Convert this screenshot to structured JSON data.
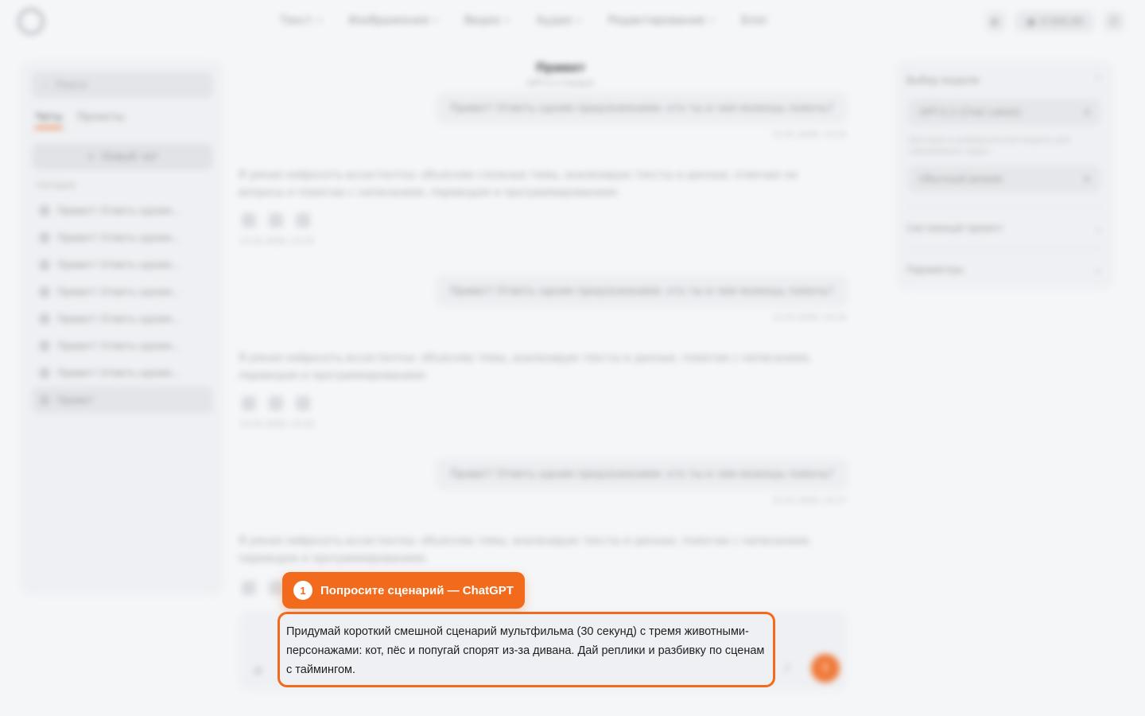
{
  "nav": {
    "items": [
      {
        "label": "Текст",
        "chevron": true
      },
      {
        "label": "Изображения",
        "chevron": true
      },
      {
        "label": "Видео",
        "chevron": true
      },
      {
        "label": "Аудио",
        "chevron": true
      },
      {
        "label": "Редактирование",
        "chevron": true
      },
      {
        "label": "Блог",
        "chevron": false
      }
    ]
  },
  "header": {
    "balance": "0 000,00"
  },
  "sidebar": {
    "search_placeholder": "Поиск",
    "tabs": [
      "Чаты",
      "Проекты"
    ],
    "new_chat": "Новый чат",
    "section": "Сегодня",
    "history": [
      "Привет! Ответь одним...",
      "Привет! Ответь одним...",
      "Привет! Ответь одним...",
      "Привет! Ответь одним...",
      "Привет! Ответь одним...",
      "Привет! Ответь одним...",
      "Привет! Ответь одним...",
      "Привет"
    ]
  },
  "chat": {
    "title": "Привет",
    "subtitle": "GPT-5.2 Instant",
    "user_messages": [
      {
        "text": "Привет! Ответь одним предложением: кто ты и чем можешь помочь?",
        "time": "12.01.2026, 14:15"
      },
      {
        "text": "Привет! Ответь одним предложением: кто ты и чем можешь помочь?",
        "time": "12.01.2026, 14:16"
      },
      {
        "text": "Привет! Ответь одним предложением: кто ты и чем можешь помочь?",
        "time": "12.01.2026, 14:17"
      }
    ],
    "bot_messages": [
      {
        "text": "Я умная нейросеть-ассистентка: объясняю сложные темы, анализирую тексты и данные, отвечаю на вопросы и помогаю с написанием, переводом и программированием.",
        "time": "12.01.2026, 14:15"
      },
      {
        "text": "Я умная нейросеть-ассистентка: объясняю темы, анализирую тексты и данные, помогаю с написанием, переводом и программированием.",
        "time": "12.01.2026, 14:16"
      },
      {
        "text": "Я умная нейросеть-ассистентка: объясняю темы, анализирую тексты и данные, помогаю с написанием, переводом и программированием.",
        "time": ""
      }
    ]
  },
  "right_panel": {
    "model_header": "Выбор модели",
    "model_value": "GPT-5.2 (Chat Latest)",
    "note": "Быстрая и универсальная модель для ежедневных задач",
    "mode_value": "Обычный режим",
    "system_prompt": "Системный промпт",
    "params": "Параметры"
  },
  "tooltip": {
    "step": "1",
    "text": "Попросите сценарий — ChatGPT"
  },
  "composer": {
    "prompt": "Придумай короткий смешной сценарий мультфильма (30 секунд) с тремя животными-персонажами: кот, пёс и попугай спорят из-за дивана. Дай реплики и разбивку по сценам с таймингом."
  },
  "colors": {
    "accent": "#f26a1b",
    "background": "#f5f6f8"
  }
}
